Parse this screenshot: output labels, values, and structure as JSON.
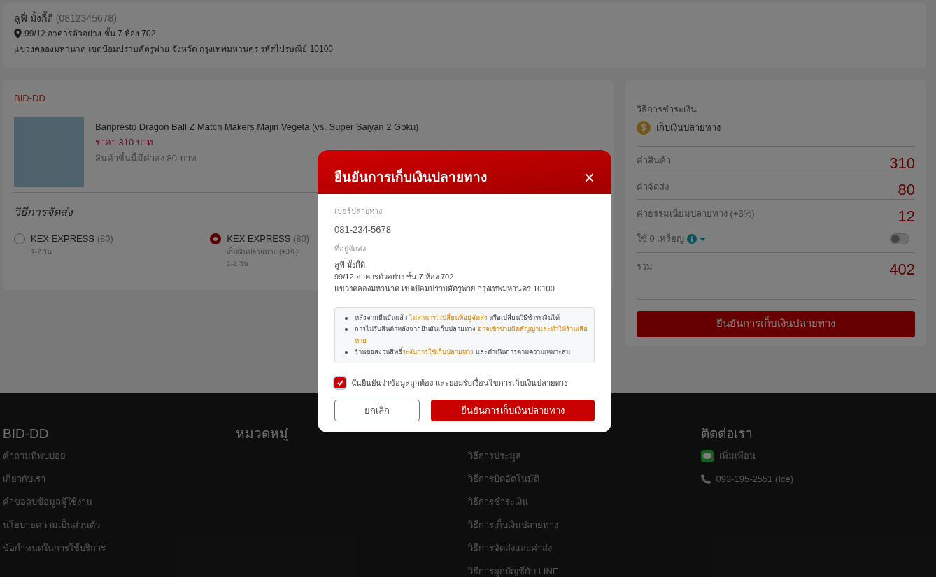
{
  "address": {
    "name": "ลูฟี่ มั้งกี้ดี",
    "phone": "(0812345678)",
    "line1": "99/12 อาคารตัวอย่าง ชั้น 7 ห้อง 702",
    "line2": "แขวงคลองมหานาค เขตป้อมปราบศัตรูพ่าย จังหวัด กรุงเทพมหานคร รหัสไปรษณีย์ 10100"
  },
  "order": {
    "shop": "BID-DD",
    "product": {
      "title": "Banpresto Dragon Ball Z Match Makers Majin Vegeta (vs. Super Saiyan 2 Goku)",
      "price": "ราคา 310 บาท",
      "shipping_note": "สินค้าชิ้นนี้มีค่าส่ง 80 บาท"
    },
    "shipping_title": "วิธีการจัดส่ง",
    "shipping_options": [
      {
        "name": "KEX EXPRESS",
        "price": "(80)",
        "notes": [
          "1-2 วัน"
        ],
        "selected": false
      },
      {
        "name": "KEX EXPRESS",
        "price": "(80)",
        "notes": [
          "เก็บเงินปลายทาง (+3%)",
          "1-2 วัน"
        ],
        "selected": true
      }
    ]
  },
  "summary": {
    "payment_label": "วิธีการชำระเงิน",
    "payment_method": "เก็บเงินปลายทาง",
    "rows": [
      {
        "kind": "amount",
        "label": "ค่าสินค้า",
        "value": "310"
      },
      {
        "kind": "amount",
        "label": "ค่าจัดส่ง",
        "value": "80"
      },
      {
        "kind": "amount",
        "label": "ค่าธรรมเนียมปลายทาง (+3%)",
        "value": "12"
      },
      {
        "kind": "coins",
        "label": "ใช้ 0 เหรียญ",
        "on": false
      },
      {
        "kind": "total",
        "label": "รวม",
        "value": "402"
      }
    ],
    "button": "ยืนยันการเก็บเงินปลายทาง"
  },
  "footer": {
    "columns": [
      {
        "title": "BID-DD",
        "links": [
          "คำถามที่พบบ่อย",
          "เกี่ยวกับเรา",
          "คำขอลบข้อมูลผู้ใช้งาน",
          "นโยบายความเป็นส่วนตัว",
          "ข้อกำหนดในการใช้บริการ"
        ]
      },
      {
        "title": "หมวดหมู่"
      },
      {
        "links": [
          "วิธีการประมูล",
          "วิธีการบิดอัตโนมัติ",
          "วิธีการชำระเงิน",
          "วิธีการเก็บเงินปลายทาง",
          "วิธีการจัดส่งและค่าส่ง",
          "วิธีการผูกบัญชีกับ LINE"
        ]
      },
      {
        "title": "ติดต่อเรา",
        "contacts": [
          {
            "kind": "line",
            "text": "เพิ่มเพื่อน"
          },
          {
            "kind": "phone",
            "text": "093-195-2551 (Ice)"
          }
        ]
      }
    ]
  },
  "modal": {
    "title": "ยืนยันการเก็บเงินปลายทาง",
    "close": "×",
    "phone_label": "เบอร์ปลายทาง",
    "phone": "081-234-5678",
    "address_label": "ที่อยู่จัดส่ง",
    "address_lines": [
      "ลูฟี่ มั้งกี้ดี",
      "99/12 อาคารตัวอย่าง ชั้น 7 ห้อง 702",
      "แขวงคลองมหานาค เขตป้อมปราบศัตรูพ่าย กรุงเทพมหานคร 10100"
    ],
    "notices": [
      "หลังจากยืนยันแล้ว **ไม่สามารถเปลี่ยนที่อยู่จัดส่ง** หรือเปลี่ยนวิธีชำระเงินได้",
      "การไม่รับสินค้าหลังจากยืนยันเก็บปลายทาง **อาจเข้าข่ายผิดสัญญาและทำให้ร้านเสียหาย**",
      "ร้านขอสงวนสิทธิ์**ระงับการใช้เก็บปลายทาง** และดำเนินการตามความเหมาะสม"
    ],
    "agree": {
      "text": "ฉันยืนยันว่าข้อมูลถูกต้อง และยอมรับเงื่อนไขการเก็บเงินปลายทาง",
      "checked": true
    },
    "cancel": "ยกเลิก",
    "confirm": "ยืนยันการเก็บเงินปลายทาง"
  }
}
